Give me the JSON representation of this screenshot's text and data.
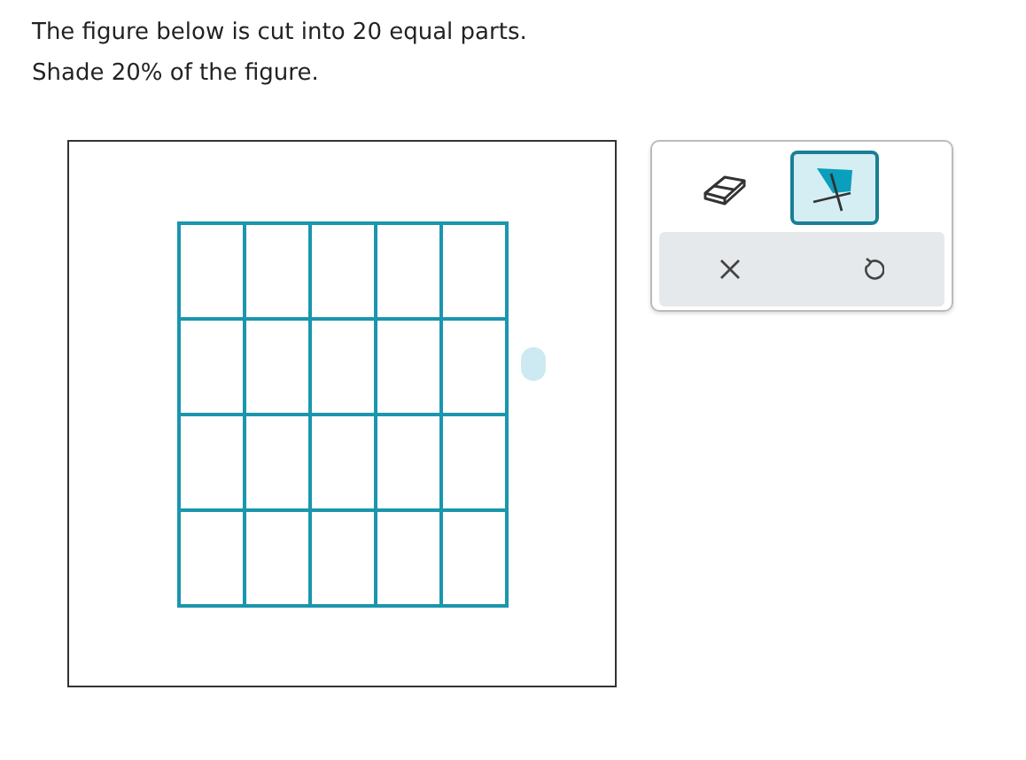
{
  "instructions": [
    "The figure below is cut into 20 equal parts.",
    "Shade 20% of the figure."
  ],
  "figure": {
    "rows": [
      {
        "cells": [
          {
            "shaded": false
          },
          {
            "shaded": false
          },
          {
            "shaded": false
          },
          {
            "shaded": false
          },
          {
            "shaded": false
          }
        ]
      },
      {
        "cells": [
          {
            "shaded": false
          },
          {
            "shaded": false
          },
          {
            "shaded": false
          },
          {
            "shaded": false
          },
          {
            "shaded": false
          }
        ]
      },
      {
        "cells": [
          {
            "shaded": false
          },
          {
            "shaded": false
          },
          {
            "shaded": false
          },
          {
            "shaded": false
          },
          {
            "shaded": false
          }
        ]
      },
      {
        "cells": [
          {
            "shaded": false
          },
          {
            "shaded": false
          },
          {
            "shaded": false
          },
          {
            "shaded": false
          },
          {
            "shaded": false
          }
        ]
      }
    ]
  },
  "tools": [
    {
      "kind": "eraser",
      "selected": false
    },
    {
      "kind": "shade",
      "selected": true
    }
  ],
  "actions": [
    {
      "kind": "clear"
    },
    {
      "kind": "undo"
    }
  ]
}
